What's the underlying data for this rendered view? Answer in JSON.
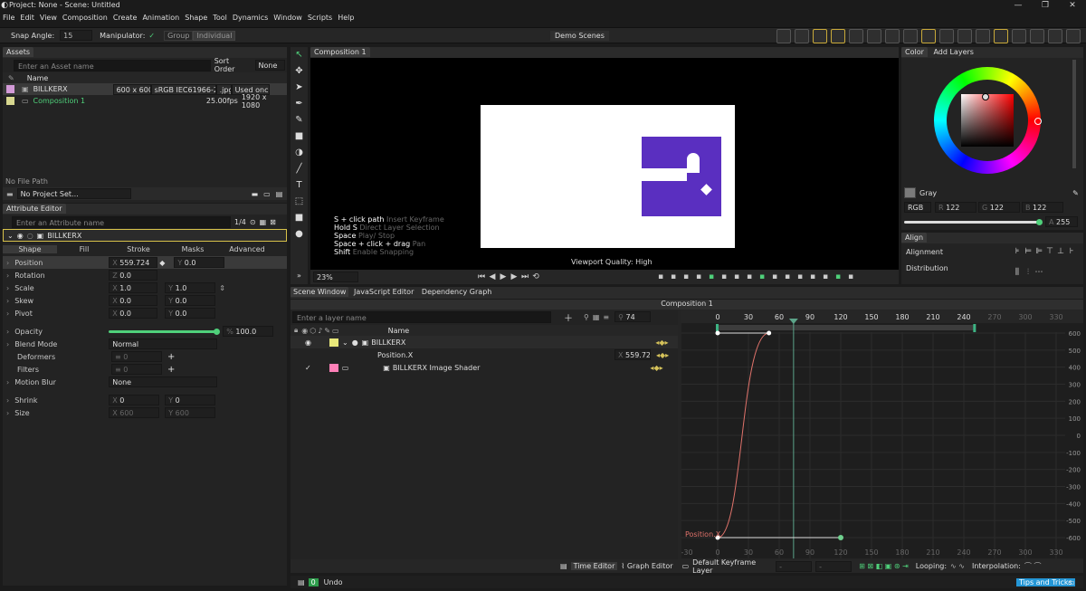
{
  "title": "Project: None - Scene: Untitled",
  "menu": [
    "File",
    "Edit",
    "View",
    "Composition",
    "Create",
    "Animation",
    "Shape",
    "Tool",
    "Dynamics",
    "Window",
    "Scripts",
    "Help"
  ],
  "toolbar": {
    "snap_label": "Snap Angle:",
    "snap_value": "15",
    "manipulator_label": "Manipulator:",
    "group_label": "Group",
    "individual_label": "Individual",
    "demo_scenes": "Demo Scenes"
  },
  "assets": {
    "tab": "Assets",
    "search_placeholder": "Enter an Asset name",
    "sort_label": "Sort Order",
    "sort_value": "None",
    "col_name": "Name",
    "items": [
      {
        "name": "BILLKERX",
        "c1": "600 x 600",
        "c2": "sRGB IEC61966-2.1",
        "c3": ".jpg",
        "c4": "Used once",
        "color": "#d39ad8"
      },
      {
        "name": "Composition 1",
        "c1": "",
        "c2": "",
        "c3": "25.00fps",
        "c4": "1920 x 1080",
        "color": "#d8d890"
      }
    ],
    "file_path": "No File Path",
    "project_set": "No Project Set..."
  },
  "attr": {
    "tab": "Attribute Editor",
    "search_placeholder": "Enter an Attribute name",
    "page": "1/4",
    "layer": "BILLKERX",
    "tabs": [
      "Shape",
      "Fill",
      "Stroke",
      "Masks",
      "Advanced"
    ],
    "position": {
      "label": "Position",
      "x": "559.724",
      "y": "0.0"
    },
    "rotation": {
      "label": "Rotation",
      "z": "0.0"
    },
    "scale": {
      "label": "Scale",
      "x": "1.0",
      "y": "1.0"
    },
    "skew": {
      "label": "Skew",
      "x": "0.0",
      "y": "0.0"
    },
    "pivot": {
      "label": "Pivot",
      "x": "0.0",
      "y": "0.0"
    },
    "opacity": {
      "label": "Opacity",
      "value": "100.0"
    },
    "blend": {
      "label": "Blend Mode",
      "value": "Normal"
    },
    "deformers": {
      "label": "Deformers",
      "value": "0"
    },
    "filters": {
      "label": "Filters",
      "value": "0"
    },
    "motion_blur": {
      "label": "Motion Blur",
      "value": "None"
    },
    "shrink": {
      "label": "Shrink",
      "x": "0",
      "y": "0"
    },
    "size": {
      "label": "Size",
      "x": "600",
      "y": "600"
    }
  },
  "viewport": {
    "tab": "Composition 1",
    "hints": [
      {
        "key": "S + click path",
        "desc": "Insert Keyframe"
      },
      {
        "key": "Hold S",
        "desc": "Direct Layer Selection"
      },
      {
        "key": "Space",
        "desc": "Play/ Stop"
      },
      {
        "key": "Space + click + drag",
        "desc": "Pan"
      },
      {
        "key": "Shift",
        "desc": "Enable Snapping"
      }
    ],
    "quality": "Viewport Quality: High",
    "zoom": "23%"
  },
  "color": {
    "tabs": [
      "Color",
      "Add Layers"
    ],
    "swatch_name": "Gray",
    "mode": "RGB",
    "r": "122",
    "g": "122",
    "b": "122",
    "a": "255"
  },
  "align": {
    "tab": "Align",
    "alignment": "Alignment",
    "distribution": "Distribution"
  },
  "bottom_tabs": [
    "Scene Window",
    "JavaScript Editor",
    "Dependency Graph"
  ],
  "timeline": {
    "comp_title": "Composition 1",
    "search_placeholder": "Enter a layer name",
    "frame": "74",
    "col_name": "Name",
    "layers": [
      {
        "name": "BILLKERX"
      },
      {
        "name": "Position.X",
        "value": "559.724"
      },
      {
        "name": "BILLKERX Image Shader"
      }
    ],
    "ruler": [
      "0",
      "30",
      "60",
      "90",
      "120",
      "150",
      "180",
      "210",
      "240",
      "270",
      "300",
      "330"
    ],
    "graph_ticks": [
      "600",
      "500",
      "400",
      "300",
      "200",
      "100",
      "0",
      "-100",
      "-200",
      "-300",
      "-400",
      "-500",
      "-600"
    ],
    "curve_label": "Position.X",
    "time_editor": "Time Editor",
    "graph_editor": "Graph Editor",
    "keyframe_layer": "Default Keyframe Layer",
    "looping": "Looping:",
    "interpolation": "Interpolation:"
  },
  "status": {
    "undo": "Undo",
    "undo_count": "0",
    "tips": "Tips and Tricks"
  }
}
